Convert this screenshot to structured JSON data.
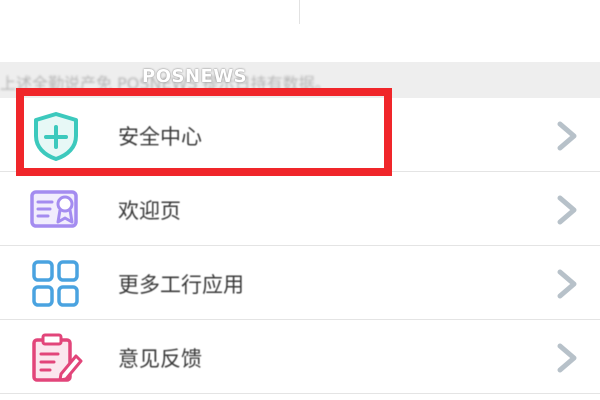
{
  "notice": {
    "text": "上述全勤说产免 POSNEWS 提示日持有数据。"
  },
  "watermark": {
    "text": "POSNEWS"
  },
  "menu": {
    "items": [
      {
        "label": "安全中心",
        "icon": "shield-plus-icon",
        "color": "#3cc9bd"
      },
      {
        "label": "欢迎页",
        "icon": "certificate-icon",
        "color": "#a48cf0"
      },
      {
        "label": "更多工行应用",
        "icon": "grid-apps-icon",
        "color": "#4aa3e0"
      },
      {
        "label": "意见反馈",
        "icon": "feedback-clipboard-icon",
        "color": "#e2457a"
      }
    ]
  },
  "colors": {
    "highlight": "#f0262a",
    "chevron": "#b7c1c9",
    "notice_bg": "#eeeeee"
  }
}
